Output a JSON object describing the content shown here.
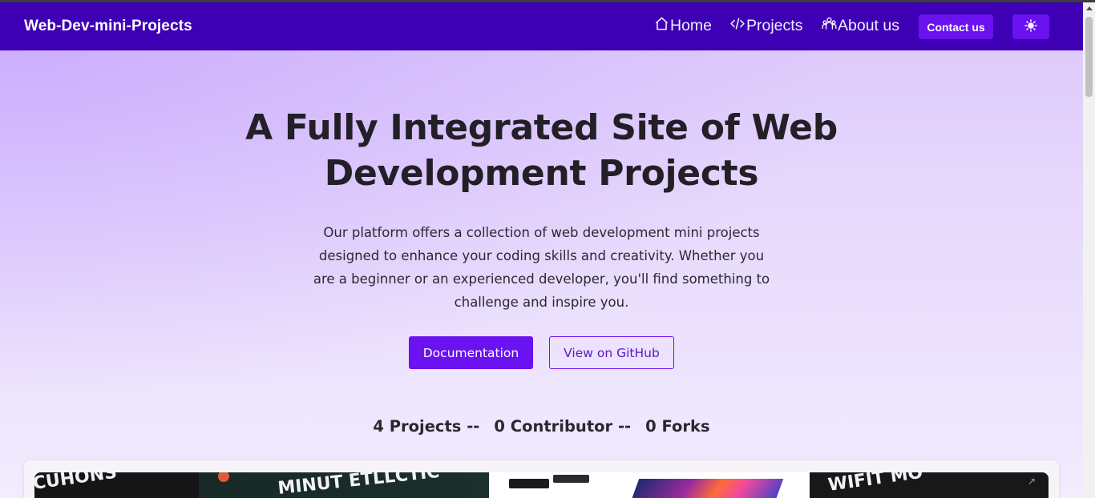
{
  "navbar": {
    "brand": "Web-Dev-mini-Projects",
    "links": [
      {
        "label": "Home",
        "icon": "home-icon"
      },
      {
        "label": "Projects",
        "icon": "code-icon"
      },
      {
        "label": "About us",
        "icon": "users-icon"
      }
    ],
    "contact_label": "Contact us",
    "theme_icon": "sun-icon"
  },
  "hero": {
    "title_line1": "A Fully Integrated Site of Web",
    "title_line2": "Development Projects",
    "description": "Our platform offers a collection of web development mini projects designed to enhance your coding skills and creativity. Whether you are a beginner or an experienced developer, you'll find something to challenge and inspire you.",
    "documentation_label": "Documentation",
    "github_label": "View on GitHub"
  },
  "stats": {
    "projects": "4 Projects --",
    "contributors": "0 Contributor --",
    "forks": "0 Forks"
  },
  "gallery": {
    "tiles": [
      {
        "text": "CUHONS"
      },
      {
        "text": "MINUT ETLLCTIC"
      },
      {
        "text": ""
      },
      {
        "text": "WIFIT MO"
      }
    ]
  },
  "colors": {
    "navbar_bg": "#3e00b5",
    "accent": "#6a12f0",
    "text_dark": "#221f27"
  }
}
